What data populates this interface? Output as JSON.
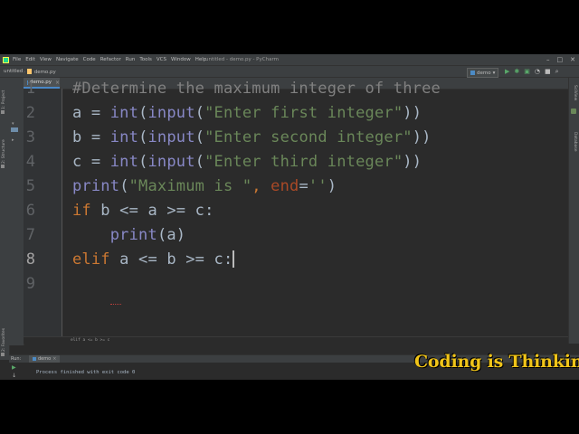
{
  "menubar": {
    "items": [
      "File",
      "Edit",
      "View",
      "Navigate",
      "Code",
      "Refactor",
      "Run",
      "Tools",
      "VCS",
      "Window",
      "Help"
    ],
    "window_title": "untitled - demo.py - PyCharm"
  },
  "navbar": {
    "project": "untitled",
    "file": "demo.py",
    "run_config": "demo"
  },
  "tool_windows": {
    "project": "1: Project",
    "structure": "2: Structure",
    "favorites": "2: Favorites"
  },
  "right_tools": {
    "scientific": "SciView",
    "database": "Database"
  },
  "editor": {
    "tab_label": "demo.py",
    "line_numbers": [
      "1",
      "2",
      "3",
      "4",
      "5",
      "6",
      "7",
      "8",
      "9"
    ],
    "breadcrumb": "elif a <= b >= c",
    "colors": {
      "background": "#2b2b2b",
      "comment": "#808080",
      "keyword": "#cc7832",
      "string": "#6a8759",
      "builtin": "#8888c6",
      "param": "#aa4926",
      "text": "#a9b7c6"
    },
    "code": {
      "l1": {
        "comment": "#Determine the maximum integer of three"
      },
      "l2": {
        "var": "a = ",
        "int": "int",
        "p1": "(",
        "input": "input",
        "p2": "(",
        "str": "\"Enter first integer\"",
        "p3": "))"
      },
      "l3": {
        "var": "b = ",
        "int": "int",
        "p1": "(",
        "input": "input",
        "p2": "(",
        "str": "\"Enter second integer\"",
        "p3": "))"
      },
      "l4": {
        "var": "c = ",
        "int": "int",
        "p1": "(",
        "input": "input",
        "p2": "(",
        "str": "\"Enter third integer\"",
        "p3": "))"
      },
      "l5": {
        "print": "print",
        "p1": "(",
        "str": "\"Maximum is \"",
        "comma": ", ",
        "kw": "end",
        "eq": "=",
        "str2": "''",
        "p2": ")"
      },
      "l6": {
        "kw": "if",
        "rest": " b <= a >= c:"
      },
      "l7": {
        "indent": "    ",
        "print": "print",
        "rest": "(a)"
      },
      "l8": {
        "kw": "elif",
        "rest": " a <= b >= c:"
      }
    }
  },
  "run": {
    "label": "Run:",
    "tab": "demo",
    "output": "Process finished with exit code 0"
  },
  "watermark": "Coding is Thinking"
}
